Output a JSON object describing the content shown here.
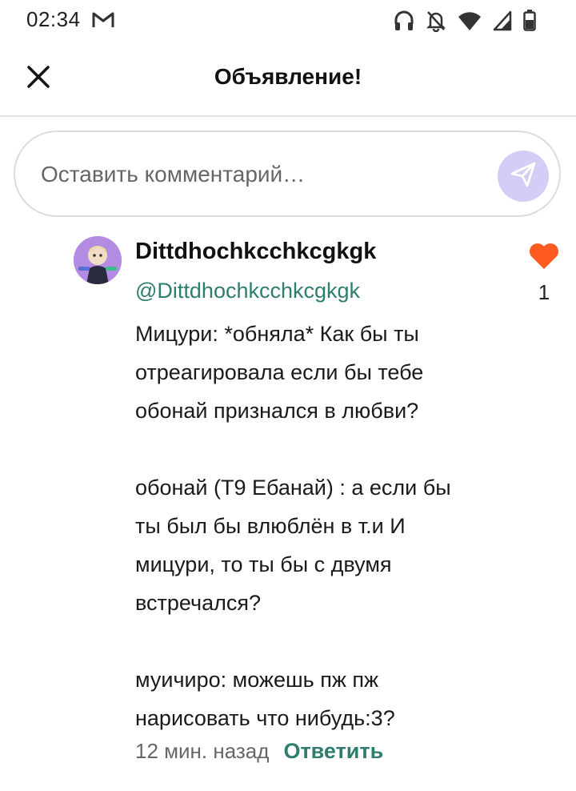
{
  "status_bar": {
    "time": "02:34",
    "icons": [
      "gmail-icon",
      "headphones-icon",
      "bell-off-icon",
      "wifi-icon",
      "signal-icon",
      "battery-icon"
    ]
  },
  "header": {
    "title": "Объявление!",
    "close_icon": "close-icon"
  },
  "comment_input": {
    "placeholder": "Оставить комментарий…",
    "send_icon": "send-icon",
    "send_bg_color": "#d5cdf6"
  },
  "comment": {
    "author_name": "Dittdhochkcchkcgkgk",
    "author_handle": "@Dittdhochkcchkcgkgk",
    "text": "Мицури: *обняла* Как бы ты\nотреагировала если бы тебе\nобонай признался в любви?\n\nобонай (Т9 Ебанай) : а если бы\nты был бы влюблён в т.и И\nмицури, то ты бы с двумя\nвстречался?\n\nмуичиро: можешь пж пж\nнарисовать что нибудь:3?",
    "time": "12 мин. назад",
    "reply_label": "Ответить",
    "like_count": "1",
    "like_color": "#ff5a1f",
    "accent_color": "#2f7d6e"
  }
}
